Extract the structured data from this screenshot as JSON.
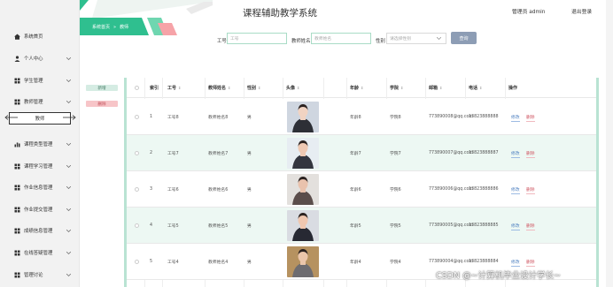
{
  "header": {
    "title": "课程辅助教学系统",
    "user_label": "管理员 admin",
    "logout": "退出登录"
  },
  "breadcrumb": {
    "home": "系统首页",
    "separator": "»",
    "current": "教师"
  },
  "sidebar": {
    "items": [
      {
        "label": "系统首页",
        "icon": "home-icon",
        "has_children": false
      },
      {
        "label": "个人中心",
        "icon": "person-icon",
        "has_children": true
      },
      {
        "label": "学生管理",
        "icon": "grid-icon",
        "has_children": true
      },
      {
        "label": "教师管理",
        "icon": "grid-icon",
        "has_children": true
      },
      {
        "label": "课程类型管理",
        "icon": "chart-icon",
        "has_children": true
      },
      {
        "label": "课程学习管理",
        "icon": "grid-icon",
        "has_children": true
      },
      {
        "label": "作业信息管理",
        "icon": "grid-icon",
        "has_children": true
      },
      {
        "label": "作业提交管理",
        "icon": "grid-icon",
        "has_children": true
      },
      {
        "label": "成绩信息管理",
        "icon": "grid-icon",
        "has_children": true
      },
      {
        "label": "在线答疑管理",
        "icon": "grid-icon",
        "has_children": true
      },
      {
        "label": "管理讨论",
        "icon": "grid-icon",
        "has_children": true
      }
    ],
    "active_sub": "教师"
  },
  "search": {
    "job_no_label": "工号",
    "job_no_placeholder": "工号",
    "name_label": "教师姓名",
    "name_placeholder": "教师姓名",
    "gender_label": "性别",
    "gender_placeholder": "请选择性别",
    "button": "查询"
  },
  "actions": {
    "add": "新增",
    "delete": "删除"
  },
  "table": {
    "columns": [
      "索引",
      "工号",
      "教师姓名",
      "性别",
      "头像",
      "年龄",
      "学院",
      "邮箱",
      "电话",
      "操作"
    ],
    "rows": [
      {
        "index": "1",
        "job_no": "工号8",
        "name": "教师姓名8",
        "gender": "男",
        "age": "年龄8",
        "college": "学院8",
        "email": "773890008@qq.com",
        "phone": "13823888888",
        "photo_colors": [
          "#cfd6e0",
          "#2d2f36",
          "#f1d3c2"
        ]
      },
      {
        "index": "2",
        "job_no": "工号7",
        "name": "教师姓名7",
        "gender": "男",
        "age": "年龄7",
        "college": "学院7",
        "email": "773890007@qq.com",
        "phone": "13823888887",
        "photo_colors": [
          "#e7edf2",
          "#33353f",
          "#efc9b3"
        ]
      },
      {
        "index": "3",
        "job_no": "工号6",
        "name": "教师姓名6",
        "gender": "男",
        "age": "年龄6",
        "college": "学院6",
        "email": "773890006@qq.com",
        "phone": "13823888886",
        "photo_colors": [
          "#e3e0dd",
          "#5b4d4b",
          "#e9c2ad"
        ]
      },
      {
        "index": "4",
        "job_no": "工号5",
        "name": "教师姓名5",
        "gender": "男",
        "age": "年龄5",
        "college": "学院5",
        "email": "773890005@qq.com",
        "phone": "13823888885",
        "photo_colors": [
          "#d9dce2",
          "#272933",
          "#efc7b0"
        ]
      },
      {
        "index": "5",
        "job_no": "工号4",
        "name": "教师姓名4",
        "gender": "男",
        "age": "年龄4",
        "college": "学院4",
        "email": "773890004@qq.com",
        "phone": "13823888884",
        "photo_colors": [
          "#b69260",
          "#6e6c70",
          "#ebc6ab"
        ]
      }
    ],
    "edit_label": "修改",
    "delete_label": "删除"
  },
  "watermark": "CSDN @~计算机毕业设计学长~",
  "colors": {
    "accent": "#2fbf8f",
    "row_alt": "#edf8f3",
    "search_btn": "#8d9db5"
  }
}
